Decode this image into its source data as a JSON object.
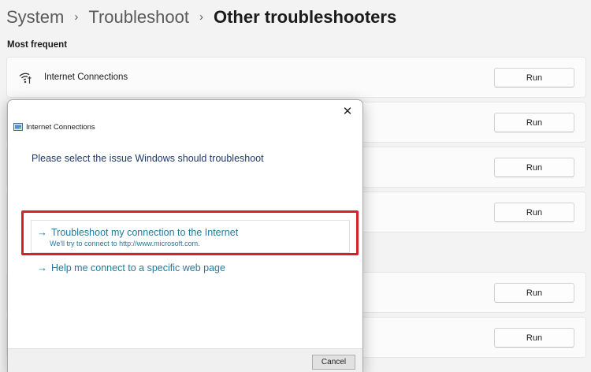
{
  "breadcrumb": {
    "items": [
      "System",
      "Troubleshoot"
    ],
    "current": "Other troubleshooters",
    "separator": "›"
  },
  "section": {
    "title": "Most frequent"
  },
  "rows": [
    {
      "label": "Internet Connections",
      "icon": "wifi-icon",
      "button": "Run"
    },
    {
      "label": "",
      "button": "Run"
    },
    {
      "label": "",
      "button": "Run"
    },
    {
      "label": "",
      "button": "Run"
    },
    {
      "label": "",
      "button": "Run"
    },
    {
      "label": "",
      "button": "Run"
    }
  ],
  "dialog": {
    "title": "Internet Connections",
    "close_symbol": "✕",
    "heading": "Please select the issue Windows should troubleshoot",
    "options": [
      {
        "arrow": "→",
        "label": "Troubleshoot my connection to the Internet",
        "description": "We'll try to connect to http://www.microsoft.com."
      },
      {
        "arrow": "→",
        "label": "Help me connect to a specific web page"
      }
    ],
    "cancel": "Cancel"
  },
  "colors": {
    "background": "#f3f3f3",
    "link": "#1f7a9c",
    "heading": "#1e3a6a",
    "highlight": "#d4222a"
  }
}
